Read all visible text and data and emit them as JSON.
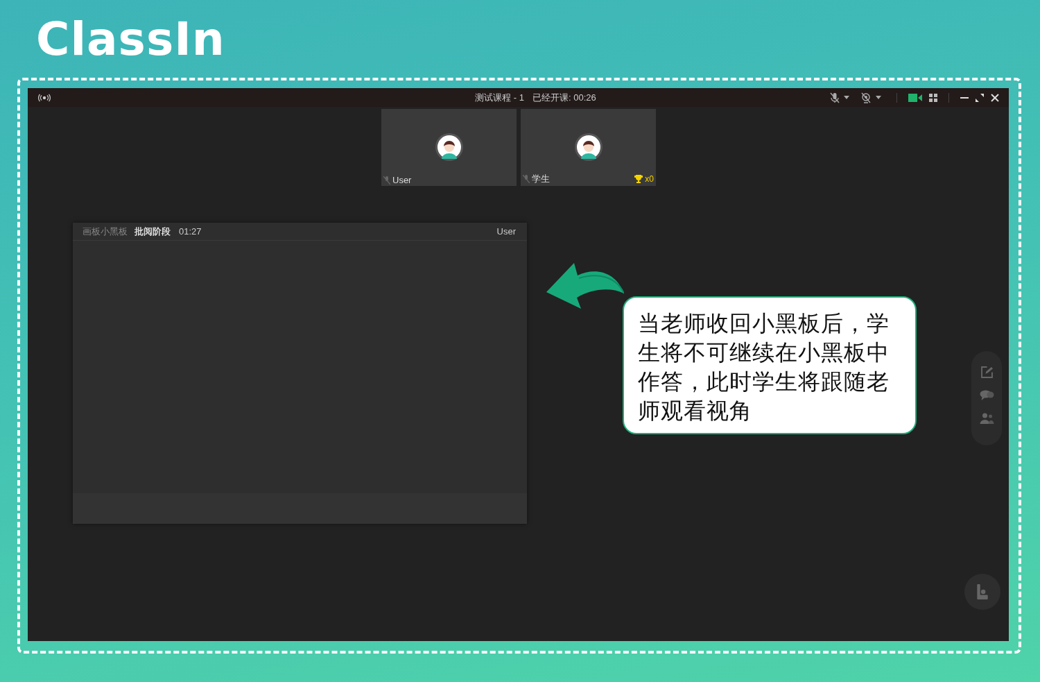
{
  "logo": {
    "text": "ClassIn"
  },
  "window": {
    "title": "测试课程 - 1",
    "elapsed": "已经开课: 00:26",
    "camera_on": true
  },
  "video_tiles": [
    {
      "name": "User"
    },
    {
      "name": "学生",
      "trophies": "x0"
    }
  ],
  "blackboard": {
    "label": "画板小黑板",
    "stage": "批阅阶段",
    "timer": "01:27",
    "owner": "User"
  },
  "callout": {
    "text": "当老师收回小黑板后，学生将不可继续在小黑板中作答，此时学生将跟随老师观看视角"
  }
}
